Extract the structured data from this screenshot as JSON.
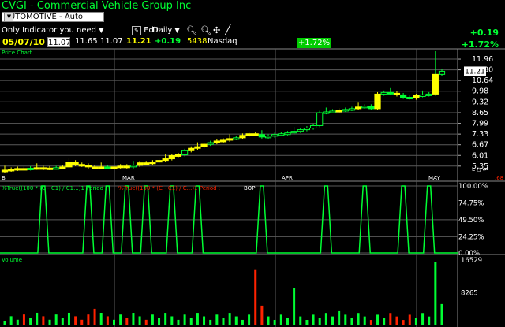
{
  "header": {
    "title": "CVGI - Commercial Vehicle Group Inc",
    "sector_select": "AUTOMOTIVE - Auto Parts",
    "indicator_select": "Only Indicator you need",
    "edit_label": "Edit",
    "period_select": "Daily"
  },
  "quote": {
    "date": "05/07/10",
    "open": "11.07",
    "high": "11.65",
    "low": "11.07",
    "last": "11.21",
    "change": "+0.19",
    "volume": "5438",
    "exchange": "Nasdaq",
    "change_pct_badge": "+1.72%",
    "change_big": "+0.19",
    "change_pct_big": "+1.72%"
  },
  "price_panel": {
    "label": "Price Chart",
    "y_ticks": [
      "11.96",
      "11.30",
      "10.64",
      "9.98",
      "9.32",
      "8.65",
      "7.99",
      "7.33",
      "6.67",
      "6.01",
      "5.35"
    ],
    "last_price_label": "11.21",
    "month_labels": [
      "B",
      "MAR",
      "APR",
      "MAY"
    ]
  },
  "indicator_panel": {
    "label_green": "%True((100 * (C - C1) / C1...)1 Period : ",
    "label_red": "%True((100 * (C - C1) / C...)1 Period : ",
    "label_bop": "BOP",
    "y_ticks": [
      "100.00%",
      "74.75%",
      "49.50%",
      "24.25%",
      "0.00%"
    ],
    "corner_value": ".68"
  },
  "volume_panel": {
    "label": "Volume",
    "y_ticks": [
      "16529",
      "8265"
    ]
  },
  "colors": {
    "up": "#00ff33",
    "down": "#ff2200",
    "candle_yellow": "#ffff00",
    "grid": "#5a5a5a",
    "accent_green": "#00cc00"
  },
  "chart_data": [
    {
      "type": "candlestick",
      "title": "Price Chart",
      "ylim": [
        5.0,
        12.4
      ],
      "x_labels": [
        "B",
        "MAR",
        "APR",
        "MAY"
      ],
      "close_approx": [
        5.1,
        5.15,
        5.2,
        5.18,
        5.22,
        5.25,
        5.2,
        5.23,
        5.25,
        5.3,
        5.6,
        5.45,
        5.4,
        5.3,
        5.25,
        5.3,
        5.25,
        5.3,
        5.35,
        5.3,
        5.4,
        5.55,
        5.5,
        5.6,
        5.7,
        5.8,
        6.0,
        6.05,
        6.3,
        6.45,
        6.55,
        6.7,
        6.8,
        6.9,
        6.95,
        7.05,
        7.1,
        7.25,
        7.35,
        7.3,
        7.15,
        7.2,
        7.3,
        7.35,
        7.4,
        7.5,
        7.6,
        7.7,
        7.85,
        8.65,
        8.7,
        8.75,
        8.8,
        8.85,
        8.9,
        9.0,
        9.05,
        8.9,
        9.8,
        9.9,
        9.85,
        9.75,
        9.6,
        9.55,
        9.7,
        9.75,
        9.8,
        11.02,
        11.21
      ]
    },
    {
      "type": "line",
      "title": "%True((100 * (C - C1) / C1...)1 Period : BOP",
      "ylim": [
        0,
        100
      ],
      "y_ticks": [
        0,
        24.25,
        49.5,
        74.75,
        100
      ],
      "spike_positions_x_index": [
        6,
        13,
        16,
        19,
        22,
        26,
        30,
        40,
        50,
        56,
        62,
        66
      ]
    },
    {
      "type": "bar",
      "title": "Volume",
      "ylim": [
        0,
        16529
      ],
      "y_ticks": [
        8265,
        16529
      ]
    }
  ]
}
